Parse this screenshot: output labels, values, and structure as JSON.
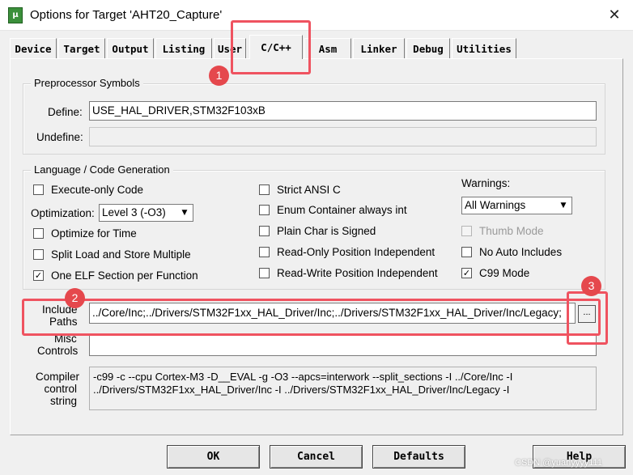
{
  "window": {
    "title": "Options for Target 'AHT20_Capture'",
    "close_glyph": "✕"
  },
  "tabs": [
    "Device",
    "Target",
    "Output",
    "Listing",
    "User",
    "C/C++",
    "Asm",
    "Linker",
    "Debug",
    "Utilities"
  ],
  "active_tab": "C/C++",
  "preprocessor": {
    "title": "Preprocessor Symbols",
    "define_label": "Define:",
    "define_value": "USE_HAL_DRIVER,STM32F103xB",
    "undefine_label": "Undefine:",
    "undefine_value": ""
  },
  "language": {
    "title": "Language / Code Generation",
    "execute_only": {
      "label": "Execute-only Code",
      "checked": false
    },
    "optimization_label": "Optimization:",
    "optimization_value": "Level 3 (-O3)",
    "optimize_time": {
      "label": "Optimize for Time",
      "checked": false
    },
    "split_load_store": {
      "label": "Split Load and Store Multiple",
      "checked": false
    },
    "one_elf": {
      "label": "One ELF Section per Function",
      "checked": true
    },
    "strict_ansi": {
      "label": "Strict ANSI C",
      "checked": false
    },
    "enum_container": {
      "label": "Enum Container always int",
      "checked": false
    },
    "plain_char": {
      "label": "Plain Char is Signed",
      "checked": false
    },
    "ro_pi": {
      "label": "Read-Only Position Independent",
      "checked": false
    },
    "rw_pi": {
      "label": "Read-Write Position Independent",
      "checked": false
    },
    "warnings_label": "Warnings:",
    "warnings_value": "All Warnings",
    "thumb_mode": {
      "label": "Thumb Mode",
      "checked": false,
      "disabled": true
    },
    "no_auto_includes": {
      "label": "No Auto Includes",
      "checked": false
    },
    "c99_mode": {
      "label": "C99 Mode",
      "checked": true
    }
  },
  "include_paths": {
    "label_line1": "Include",
    "label_line2": "Paths",
    "value": "../Core/Inc;../Drivers/STM32F1xx_HAL_Driver/Inc;../Drivers/STM32F1xx_HAL_Driver/Inc/Legacy;",
    "browse_label": "..."
  },
  "misc_controls": {
    "label_line1": "Misc",
    "label_line2": "Controls",
    "value": ""
  },
  "compiler_control": {
    "label_line1": "Compiler",
    "label_line2": "control",
    "label_line3": "string",
    "line1": "-c99 -c --cpu Cortex-M3 -D__EVAL -g -O3 --apcs=interwork --split_sections -I ../Core/Inc -I",
    "line2": "../Drivers/STM32F1xx_HAL_Driver/Inc -I ../Drivers/STM32F1xx_HAL_Driver/Inc/Legacy -I"
  },
  "buttons": {
    "ok": "OK",
    "cancel": "Cancel",
    "defaults": "Defaults",
    "help": "Help"
  },
  "annotations": {
    "badge1": "1",
    "badge2": "2",
    "badge3": "3",
    "color": "#ef5360"
  },
  "watermark": "CSDN @yuanyyyy111"
}
